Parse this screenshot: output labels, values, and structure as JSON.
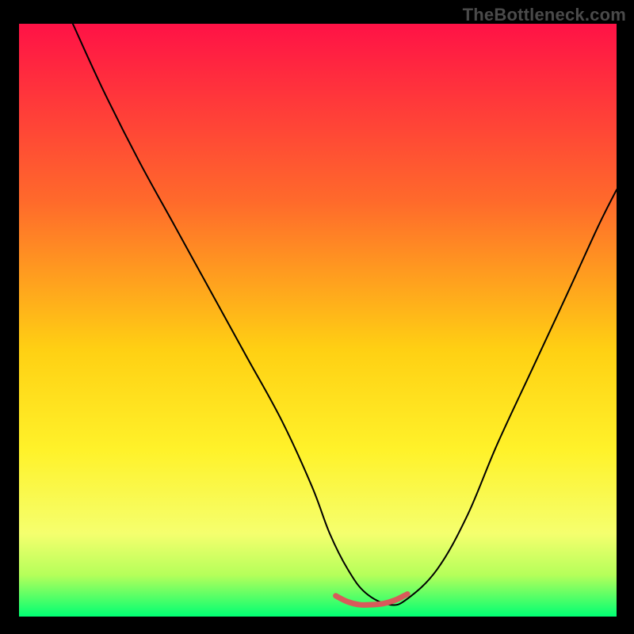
{
  "watermark": "TheBottleneck.com",
  "chart_data": {
    "type": "line",
    "title": "",
    "xlabel": "",
    "ylabel": "",
    "xlim": [
      0,
      100
    ],
    "ylim": [
      0,
      100
    ],
    "grid": false,
    "legend": false,
    "gradient_stops": [
      {
        "offset": 0,
        "color": "#ff1246"
      },
      {
        "offset": 30,
        "color": "#ff6a2b"
      },
      {
        "offset": 55,
        "color": "#ffd013"
      },
      {
        "offset": 72,
        "color": "#fff22a"
      },
      {
        "offset": 86,
        "color": "#f5ff6e"
      },
      {
        "offset": 93,
        "color": "#b5ff5a"
      },
      {
        "offset": 100,
        "color": "#00ff73"
      }
    ],
    "series": [
      {
        "name": "bottleneck-curve",
        "stroke": "#000000",
        "stroke_width": 2,
        "x": [
          9,
          14,
          20,
          26,
          32,
          38,
          44,
          49,
          52,
          55,
          58,
          62,
          65,
          70,
          75,
          80,
          86,
          92,
          97,
          100
        ],
        "y": [
          100,
          89,
          77,
          66,
          55,
          44,
          33,
          22,
          14,
          8,
          4,
          2,
          3,
          8,
          17,
          29,
          42,
          55,
          66,
          72
        ]
      },
      {
        "name": "valley-highlight",
        "stroke": "#d85a5a",
        "stroke_width": 7,
        "x": [
          53,
          55,
          57,
          59,
          61,
          63,
          65
        ],
        "y": [
          3.5,
          2.5,
          2,
          2,
          2.2,
          2.8,
          3.8
        ]
      }
    ]
  }
}
